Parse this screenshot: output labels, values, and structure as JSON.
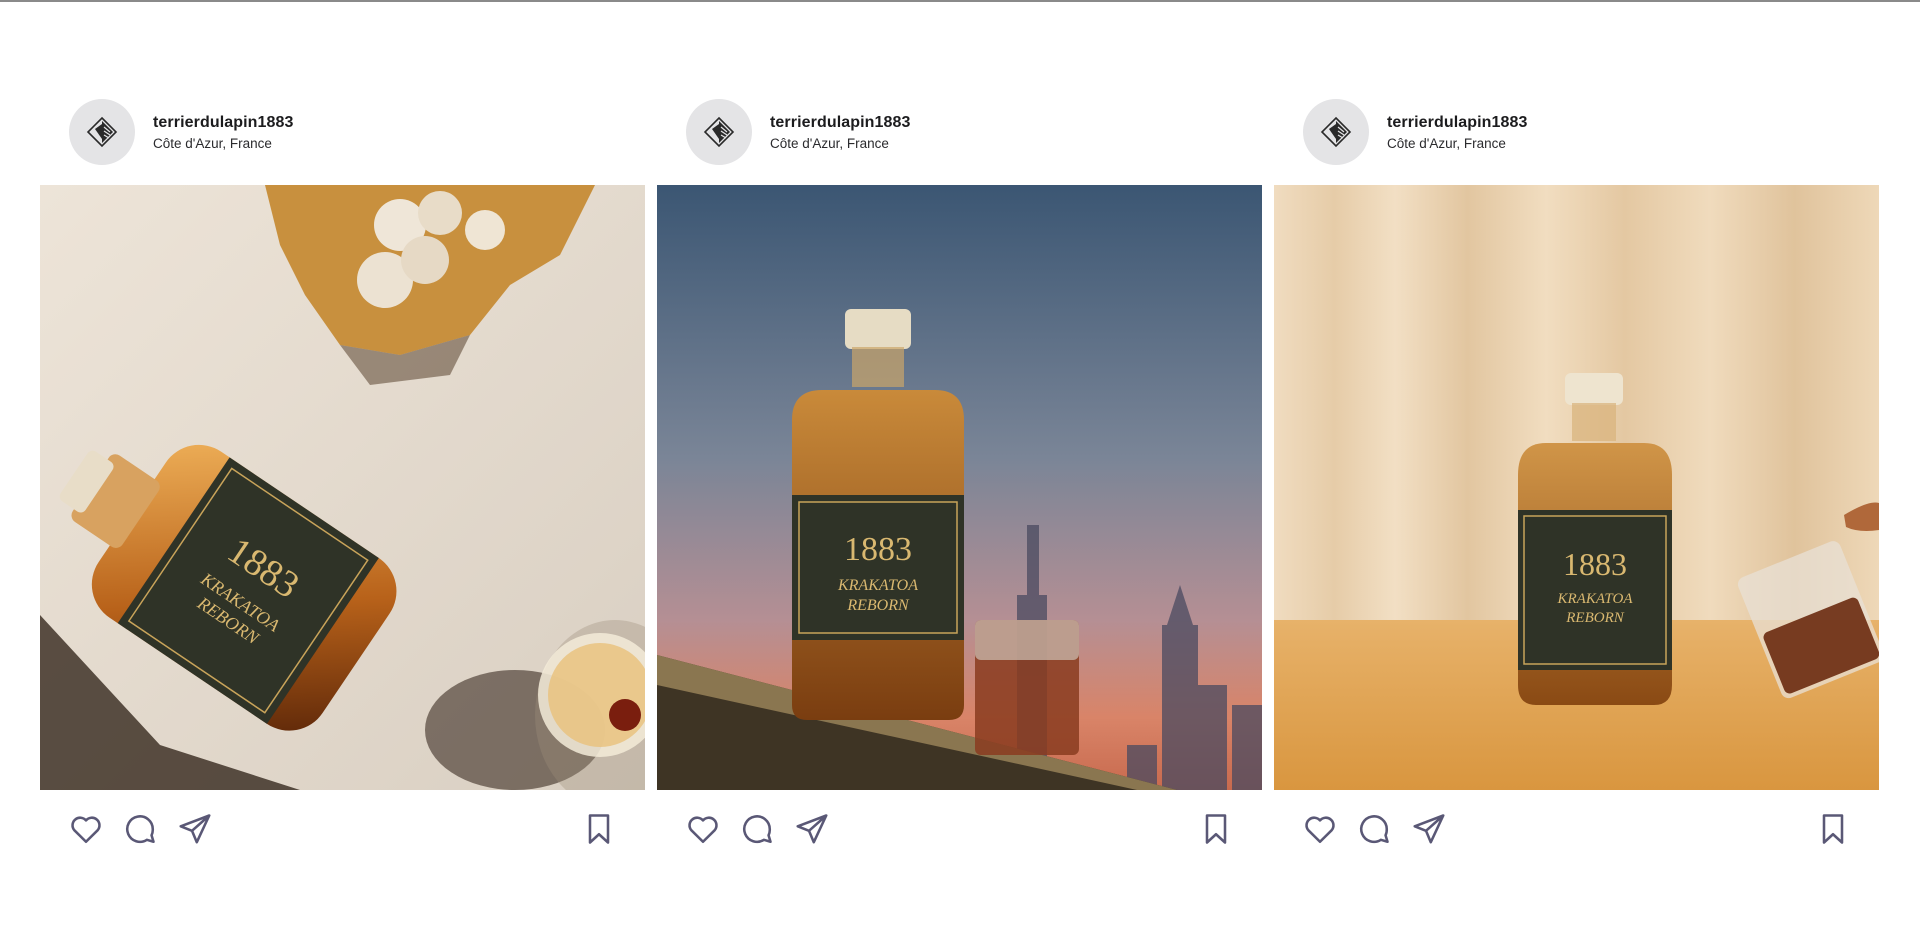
{
  "posts": [
    {
      "username": "terrierdulapin1883",
      "location": "Côte d'Azur, France",
      "photo_icon": "whisky-bottle-with-glass-flatlay",
      "label": {
        "year": "1883",
        "name1": "KRAKATOA",
        "name2": "REBORN"
      }
    },
    {
      "username": "terrierdulapin1883",
      "location": "Côte d'Azur, France",
      "photo_icon": "whisky-bottle-skyline-sunset",
      "label": {
        "year": "1883",
        "name1": "KRAKATOA",
        "name2": "REBORN"
      }
    },
    {
      "username": "terrierdulapin1883",
      "location": "Côte d'Azur, France",
      "photo_icon": "whisky-bottle-on-table-curtain",
      "label": {
        "year": "1883",
        "name1": "KRAKATOA",
        "name2": "REBORN"
      }
    }
  ],
  "icons": {
    "avatar": "brand-logo-icon",
    "like": "heart-icon",
    "comment": "comment-icon",
    "share": "send-icon",
    "save": "bookmark-icon"
  },
  "colors": {
    "icon_stroke": "#5a5876",
    "username": "#1c1c1e",
    "avatar_bg": "#e4e4e6"
  }
}
